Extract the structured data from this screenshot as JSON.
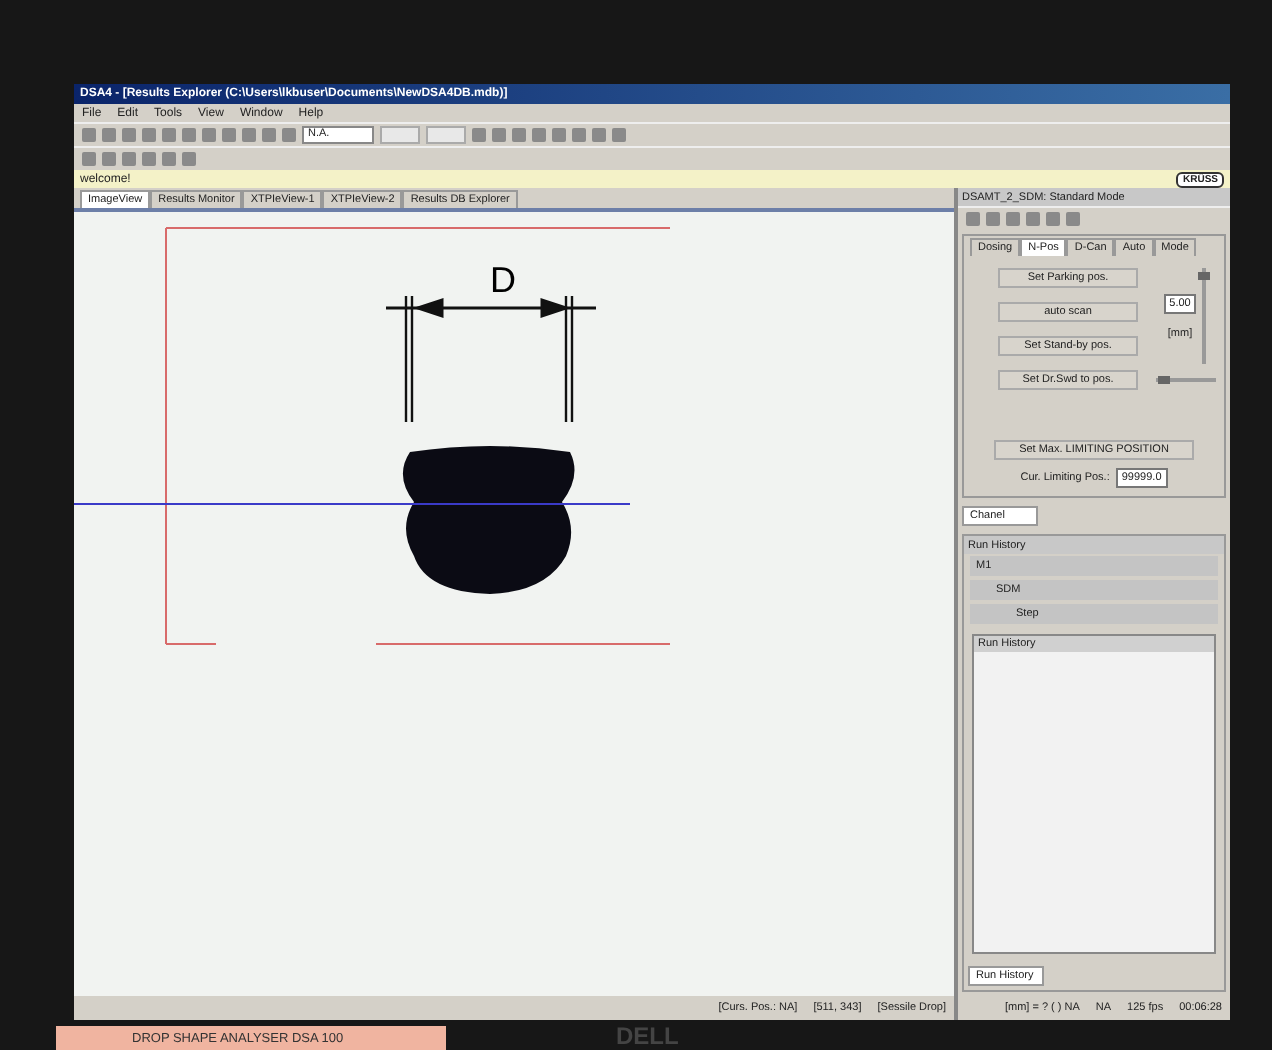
{
  "window": {
    "title": "DSA4 - [Results Explorer (C:\\Users\\lkbuser\\Documents\\NewDSA4DB.mdb)]"
  },
  "menu": [
    "File",
    "Edit",
    "Tools",
    "View",
    "Window",
    "Help"
  ],
  "toolbar": {
    "combo_value": "N.A."
  },
  "message_bar": {
    "text": "welcome!",
    "logo": "KRÜSS"
  },
  "tabs": [
    {
      "label": "ImageView",
      "selected": true
    },
    {
      "label": "Results Monitor",
      "selected": false
    },
    {
      "label": "XTPIeView-1",
      "selected": false
    },
    {
      "label": "XTPIeView-2",
      "selected": false
    },
    {
      "label": "Results DB Explorer",
      "selected": false
    }
  ],
  "image_view": {
    "dimension_label": "D"
  },
  "control_panel": {
    "title": "DSAMT_2_SDM: Standard Mode",
    "tabs": [
      {
        "label": "Dosing",
        "selected": false
      },
      {
        "label": "N-Pos",
        "selected": true
      },
      {
        "label": "D-Can",
        "selected": false
      },
      {
        "label": "Auto",
        "selected": false
      },
      {
        "label": "Mode",
        "selected": false
      }
    ],
    "buttons": [
      "Set Parking pos.",
      "auto scan",
      "Set Stand-by pos.",
      "Set Dr.Swd to pos."
    ],
    "value": "5.00",
    "unit": "[mm]",
    "vertical_slider": {
      "level": 0.95
    },
    "horizontal_slider": {
      "level": 0.05
    },
    "limit_button": "Set Max. LIMITING POSITION",
    "limit_label": "Cur. Limiting Pos.:",
    "limit_value": "99999.0"
  },
  "channel_tab": "Chanel",
  "run_history": {
    "title": "Run History",
    "tree": [
      {
        "label": "M1",
        "children": [
          {
            "label": "SDM",
            "children": [
              {
                "label": "Step"
              }
            ]
          }
        ]
      }
    ],
    "list_header": "Run History",
    "bottom_tab": "Run History"
  },
  "status_bar": [
    "[Curs. Pos.: NA]",
    "[511, 343]",
    "[Sessile Drop]",
    "[mm] = ? ( ) NA",
    "NA",
    "125 fps",
    "00:06:28"
  ],
  "bezel": {
    "label": "DROP SHAPE ANALYSER DSA 100",
    "brand": "DELL"
  }
}
